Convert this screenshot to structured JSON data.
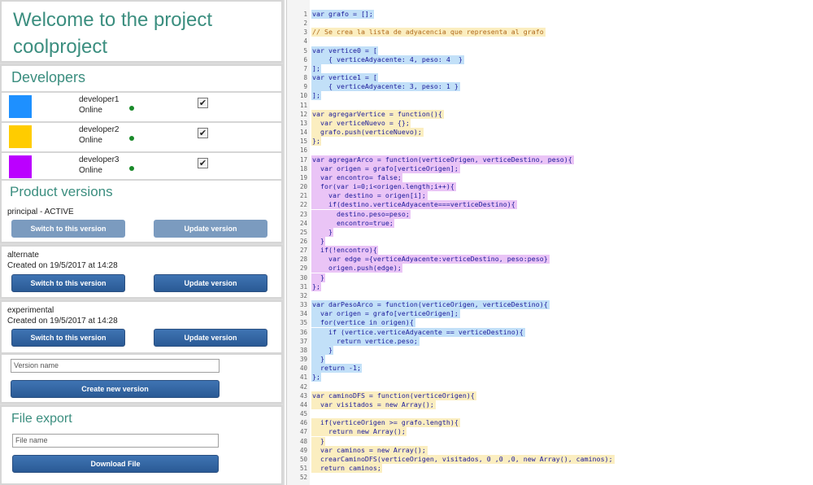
{
  "welcome": {
    "title": "Welcome to the project coolproject"
  },
  "developers": {
    "title": "Developers",
    "items": [
      {
        "name": "developer1",
        "status": "Online",
        "color": "#1e90ff",
        "checked": true
      },
      {
        "name": "developer2",
        "status": "Online",
        "color": "#ffcc00",
        "checked": true
      },
      {
        "name": "developer3",
        "status": "Online",
        "color": "#bb00ff",
        "checked": true
      }
    ]
  },
  "versions": {
    "title": "Product versions",
    "items": [
      {
        "name": "principal - ACTIVE",
        "created": "",
        "switch_label": "Switch to this version",
        "update_label": "Update version",
        "active": true
      },
      {
        "name": "alternate",
        "created": "Created on 19/5/2017 at 14:28",
        "switch_label": "Switch to this version",
        "update_label": "Update version",
        "active": false
      },
      {
        "name": "experimental",
        "created": "Created on 19/5/2017 at 14:28",
        "switch_label": "Switch to this version",
        "update_label": "Update version",
        "active": false
      }
    ],
    "new_version": {
      "placeholder": "Version name",
      "button_label": "Create new version"
    }
  },
  "file_export": {
    "title": "File export",
    "placeholder": "File name",
    "button_label": "Download File"
  },
  "colors": {
    "accent": "#3b8e7f",
    "button": "#2d5f9a",
    "online": "#1a8a2a"
  },
  "code": {
    "lines": [
      "var grafo = [];",
      "",
      "// Se crea la lista de adyacencia que representa al grafo",
      "",
      "var vertice0 = [",
      "    { verticeAdyacente: 4, peso: 4  }",
      "];",
      "var vertice1 = [",
      "    { verticeAdyacente: 3, peso: 1 }",
      "];",
      "",
      "var agregarVertice = function(){",
      "  var verticeNuevo = {};",
      "  grafo.push(verticeNuevo);",
      "};",
      "",
      "var agregarArco = function(verticeOrigen, verticeDestino, peso){",
      "  var origen = grafo[verticeOrigen];",
      "  var encontro= false;",
      "  for(var i=0;i<origen.length;i++){",
      "    var destino = origen[i];",
      "    if(destino.verticeAdyacente===verticeDestino){",
      "      destino.peso=peso;",
      "      encontro=true;",
      "    }",
      "  }",
      "  if(!encontro){",
      "    var edge ={verticeAdyacente:verticeDestino, peso:peso}",
      "    origen.push(edge);",
      "  }",
      "};",
      "",
      "var darPesoArco = function(verticeOrigen, verticeDestino){",
      "  var origen = grafo[verticeOrigen];",
      "  for(vertice in origen){",
      "    if (vertice.verticeAdyacente == verticeDestino){",
      "      return vertice.peso;",
      "    }",
      "  }",
      "  return -1;",
      "};",
      "",
      "var caminoDFS = function(verticeOrigen){",
      "  var visitados = new Array();",
      "",
      "  if(verticeOrigen >= grafo.length){",
      "    return new Array();",
      "  }",
      "  var caminos = new Array();",
      "  crearCaminoDFS(verticeOrigen, visitados, 0 ,0 ,0, new Array(), caminos);",
      "  return caminos;",
      ""
    ],
    "highlights": [
      "blue",
      "none",
      "yellow",
      "none",
      "blue",
      "blue",
      "blue",
      "blue",
      "blue",
      "blue",
      "none",
      "yellow",
      "yellow",
      "yellow",
      "yellow",
      "none",
      "purple",
      "purple",
      "purple",
      "purple",
      "purple",
      "purple",
      "purple",
      "purple",
      "purple",
      "purple",
      "purple",
      "purple",
      "purple",
      "purple",
      "purple",
      "none",
      "blue",
      "blue",
      "blue",
      "blue",
      "blue",
      "blue",
      "blue",
      "blue",
      "blue",
      "none",
      "yellow",
      "yellow",
      "yellow",
      "yellow",
      "yellow",
      "yellow",
      "yellow",
      "yellow",
      "yellow",
      "yellow"
    ]
  }
}
